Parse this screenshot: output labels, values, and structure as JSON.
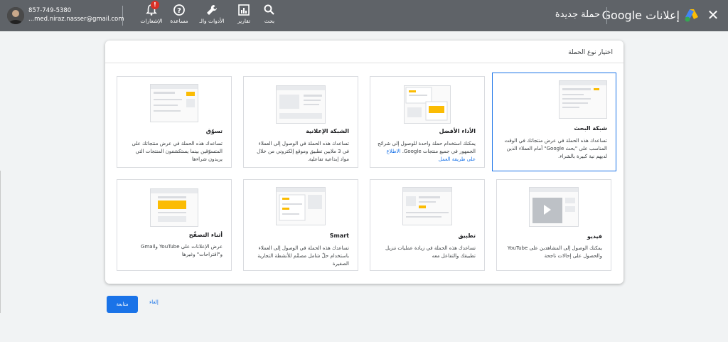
{
  "header": {
    "close_icon": "close-icon",
    "brand": "إعلانات Google",
    "campaign": "حملة جديدة",
    "tools": [
      {
        "label": "بحث",
        "icon": "search-icon"
      },
      {
        "label": "تقارير",
        "icon": "bar-chart-icon"
      },
      {
        "label": "الأدوات والـ",
        "icon": "wrench-icon"
      },
      {
        "label": "مساعدة",
        "icon": "help-icon"
      },
      {
        "label": "الإشعارات",
        "icon": "bell-icon"
      }
    ],
    "notification_badge": "!",
    "phone": "857-749-5380",
    "email": "...med.niraz.nasser@gmail.com"
  },
  "dialog": {
    "title": "اختيار نوع الحملة",
    "cards": [
      {
        "title": "شبكة البحث",
        "desc": "تساعدك هذه الحملة في عرض منتجاتك في الوقت المناسب على \"بحث Google\" أمام العملاء الذين لديهم نية كبيرة بالشراء.",
        "link": ""
      },
      {
        "title": "الأداء الأفضل",
        "desc": "يمكنك استخدام حملة واحدة للوصول إلى شرائح الجمهور في جميع منتجات Google.",
        "link": "الاطلاع على طريقة العمل"
      },
      {
        "title": "الشبكة الإعلانية",
        "desc": "تساعدك هذه الحملة في الوصول إلى العملاء في 3 ملايين تطبيق وموقع إلكتروني من خلال مواد إبداعية تفاعلية.",
        "link": ""
      },
      {
        "title": "تسوّق",
        "desc": "تساعدك هذه الحملة في عرض منتجاتك على المتسوّقين بينما يستكشفون المنتجات التي يريدون شراءها",
        "link": ""
      },
      {
        "title": "فيديو",
        "desc": "يمكنك الوصول إلى المشاهدين على YouTube والحصول على إحالات ناجحة",
        "link": ""
      },
      {
        "title": "تطبيق",
        "desc": "تساعدك هذه الحملة في زيادة عمليات تنزيل تطبيقك والتفاعل معه",
        "link": ""
      },
      {
        "title": "Smart",
        "desc": "تساعدك هذه الحملة في الوصول إلى العملاء باستخدام حلّ شامل مصمَّم للأنشطة التجارية الصغيرة",
        "link": ""
      },
      {
        "title": "أثناء التصفّح",
        "desc": "عرض الإعلانات على YouTube وGmail و\"اقتراحات\" وغيرها",
        "link": ""
      }
    ],
    "selected_index": 0
  },
  "actions": {
    "continue": "متابعة",
    "cancel": "إلغاء"
  },
  "colors": {
    "topbar": "#5f6368",
    "accent": "#1a73e8",
    "yellow": "#fbbc04"
  }
}
